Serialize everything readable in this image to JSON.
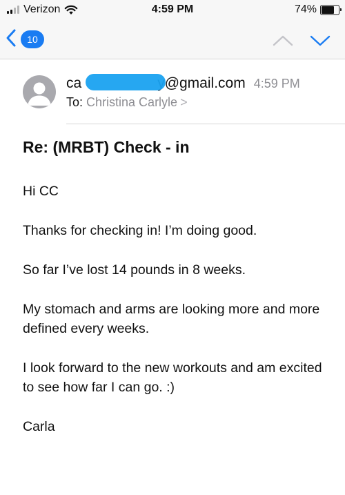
{
  "status_bar": {
    "carrier": "Verizon",
    "time": "4:59 PM",
    "battery_percent": "74%",
    "battery_level": 0.74,
    "icons": [
      "signal-icon",
      "wifi-icon",
      "battery-icon"
    ]
  },
  "nav": {
    "unread_count": "10",
    "icons": [
      "back-chevron-icon",
      "up-arrow-icon",
      "down-arrow-icon"
    ],
    "accent_color": "#1a7cf2"
  },
  "email": {
    "from_prefix": "ca",
    "from_suffix": "y@gmail.com",
    "time": "4:59 PM",
    "to_label": "To:",
    "to_name": "Christina Carlyle",
    "to_chevron": ">",
    "subject": "Re:  (MRBT) Check - in",
    "body": [
      "Hi CC",
      "Thanks for checking in!  I’m doing good.",
      "So far I’ve lost 14 pounds in 8 weeks.",
      "My stomach and arms are looking more and more defined every weeks.",
      "I look forward to the new workouts and am excited to see how far I can go.  :)",
      "Carla"
    ]
  }
}
